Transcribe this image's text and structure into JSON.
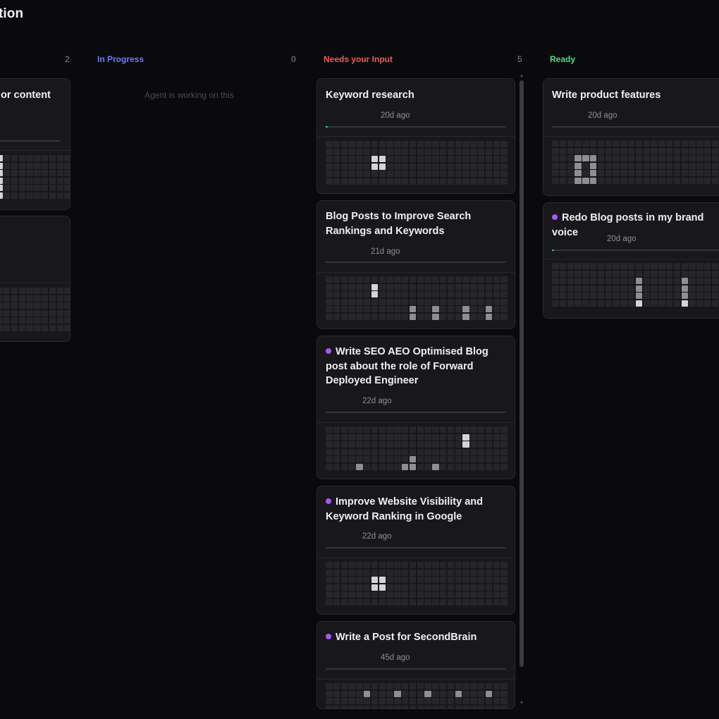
{
  "page": {
    "title": "tion"
  },
  "columns": [
    {
      "label": "",
      "count": "2",
      "color": "#8a8a90"
    },
    {
      "label": "In Progress",
      "count": "0",
      "color": "#6b7cff",
      "empty_text": "Agent is working on this"
    },
    {
      "label": "Needs your Input",
      "count": "5",
      "color": "#ef5b5b"
    },
    {
      "label": "Ready",
      "count": "",
      "color": "#4ade80"
    }
  ],
  "cards": {
    "left": [
      {
        "title": "or content"
      },
      {
        "title": ""
      }
    ],
    "needs": [
      {
        "title": "Keyword research",
        "time": "20d ago",
        "dot": false,
        "progress": 0.01
      },
      {
        "title": "Blog Posts to Improve Search Rankings and Keywords",
        "time": "21d ago",
        "dot": false,
        "progress": 0
      },
      {
        "title": "Write SEO AEO Optimised Blog post about the role of Forward Deployed Engineer",
        "time": "22d ago",
        "dot": true,
        "progress": 0
      },
      {
        "title": "Improve Website Visibility and Keyword Ranking in Google",
        "time": "22d ago",
        "dot": true,
        "progress": 0
      },
      {
        "title": "Write a Post for SecondBrain",
        "time": "45d ago",
        "dot": true,
        "progress": 0
      }
    ],
    "ready": [
      {
        "title": "Write product features",
        "time": "20d ago",
        "dot": false,
        "progress": 0
      },
      {
        "title": "Redo Blog posts in my brand voice",
        "time": "20d ago",
        "dot": true,
        "progress": 0.01
      }
    ]
  },
  "scrollbar": {
    "up_glyph": "▲",
    "down_glyph": "▼"
  },
  "colors": {
    "background": "#0a0a0c",
    "card": "#18181b",
    "accent_dot": "#a855f7",
    "progress_fill": "#2dd4bf"
  }
}
